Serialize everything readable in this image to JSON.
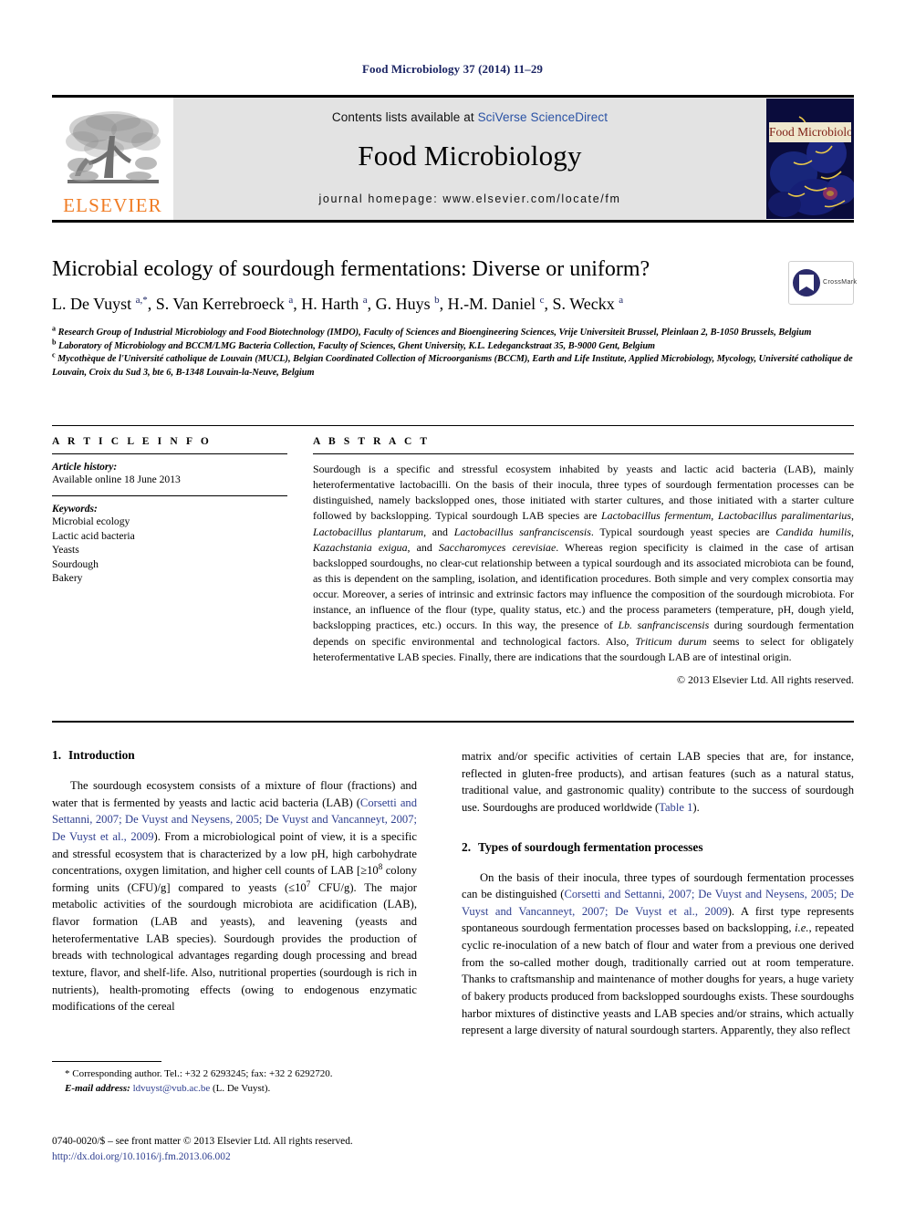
{
  "running_head": "Food Microbiology 37 (2014) 11–29",
  "masthead": {
    "publisher_name": "ELSEVIER",
    "contents_prefix": "Contents lists available at ",
    "contents_link": "SciVerse ScienceDirect",
    "journal_title": "Food Microbiology",
    "homepage": "journal homepage: www.elsevier.com/locate/fm",
    "cover_title": "Food Microbiology"
  },
  "article": {
    "title": "Microbial ecology of sourdough fermentations: Diverse or uniform?",
    "authors_html": "L. De Vuyst <sup>a,*</sup>, S. Van Kerrebroeck <sup>a</sup>, H. Harth <sup>a</sup>, G. Huys <sup>b</sup>, H.-M. Daniel <sup>c</sup>, S. Weckx <sup>a</sup>",
    "crossmark_label": "CrossMark",
    "affiliations": [
      "<sup>a</sup> Research Group of Industrial Microbiology and Food Biotechnology (IMDO), Faculty of Sciences and Bioengineering Sciences, Vrije Universiteit Brussel, Pleinlaan 2, B-1050 Brussels, Belgium",
      "<sup>b</sup> Laboratory of Microbiology and BCCM/LMG Bacteria Collection, Faculty of Sciences, Ghent University, K.L. Ledeganckstraat 35, B-9000 Gent, Belgium",
      "<sup>c</sup> Mycoth&egrave;que de l'Universit&eacute; catholique de Louvain (MUCL), Belgian Coordinated Collection of Microorganisms (BCCM), Earth and Life Institute, Applied Microbiology, Mycology, Universit&eacute; catholique de Louvain, Croix du Sud 3, bte 6, B-1348 Louvain-la-Neuve, Belgium"
    ]
  },
  "article_info": {
    "heading": "A R T I C L E  I N F O",
    "history_label": "Article history:",
    "history_value": "Available online 18 June 2013",
    "keywords_label": "Keywords:",
    "keywords": [
      "Microbial ecology",
      "Lactic acid bacteria",
      "Yeasts",
      "Sourdough",
      "Bakery"
    ]
  },
  "abstract": {
    "heading": "A B S T R A C T",
    "text_html": "Sourdough is a specific and stressful ecosystem inhabited by yeasts and lactic acid bacteria (LAB), mainly heterofermentative lactobacilli. On the basis of their inocula, three types of sourdough fermentation processes can be distinguished, namely backslopped ones, those initiated with starter cultures, and those initiated with a starter culture followed by backslopping. Typical sourdough LAB species are <i>Lactobacillus fermentum</i>, <i>Lactobacillus paralimentarius</i>, <i>Lactobacillus plantarum</i>, and <i>Lactobacillus sanfranciscensis</i>. Typical sourdough yeast species are <i>Candida humilis</i>, <i>Kazachstania exigua</i>, and <i>Saccharomyces cerevisiae</i>. Whereas region specificity is claimed in the case of artisan backslopped sourdoughs, no clear-cut relationship between a typical sourdough and its associated microbiota can be found, as this is dependent on the sampling, isolation, and identification procedures. Both simple and very complex consortia may occur. Moreover, a series of intrinsic and extrinsic factors may influence the composition of the sourdough microbiota. For instance, an influence of the flour (type, quality status, etc.) and the process parameters (temperature, pH, dough yield, backslopping practices, etc.) occurs. In this way, the presence of <i>Lb. sanfranciscensis</i> during sourdough fermentation depends on specific environmental and technological factors. Also, <i>Triticum durum</i> seems to select for obligately heterofermentative LAB species. Finally, there are indications that the sourdough LAB are of intestinal origin.",
    "copyright": "© 2013 Elsevier Ltd. All rights reserved."
  },
  "body": {
    "section1": {
      "number": "1.",
      "title": "Introduction",
      "paragraph_html": "The sourdough ecosystem consists of a mixture of flour (fractions) and water that is fermented by yeasts and lactic acid bacteria (LAB) (<span class=\"ref\">Corsetti and Settanni, 2007; De Vuyst and Neysens, 2005; De Vuyst and Vancanneyt, 2007; De Vuyst et al., 2009</span>). From a microbiological point of view, it is a specific and stressful ecosystem that is characterized by a low pH, high carbohydrate concentrations, oxygen limitation, and higher cell counts of LAB [&ge;10<sup>8</sup> colony forming units (CFU)/g] compared to yeasts (&le;10<sup>7</sup> CFU/g). The major metabolic activities of the sourdough microbiota are acidification (LAB), flavor formation (LAB and yeasts), and leavening (yeasts and heterofermentative LAB species). Sourdough provides the production of breads with technological advantages regarding dough processing and bread texture, flavor, and shelf-life. Also, nutritional properties (sourdough is rich in nutrients), health-promoting effects (owing to endogenous enzymatic modifications of the cereal"
    },
    "right_continued_html": "matrix and/or specific activities of certain LAB species that are, for instance, reflected in gluten-free products), and artisan features (such as a natural status, traditional value, and gastronomic quality) contribute to the success of sourdough use. Sourdoughs are produced worldwide (<span class=\"ref\">Table 1</span>).",
    "section2": {
      "number": "2.",
      "title": "Types of sourdough fermentation processes",
      "paragraph_html": "On the basis of their inocula, three types of sourdough fermentation processes can be distinguished (<span class=\"ref\">Corsetti and Settanni, 2007; De Vuyst and Neysens, 2005; De Vuyst and Vancanneyt, 2007; De Vuyst et al., 2009</span>). A first type represents spontaneous sourdough fermentation processes based on backslopping, <i>i.e.</i>, repeated cyclic re-inoculation of a new batch of flour and water from a previous one derived from the so-called mother dough, traditionally carried out at room temperature. Thanks to craftsmanship and maintenance of mother doughs for years, a huge variety of bakery products produced from backslopped sourdoughs exists. These sourdoughs harbor mixtures of distinctive yeasts and LAB species and/or strains, which actually represent a large diversity of natural sourdough starters. Apparently, they also reflect"
    }
  },
  "footnote": {
    "corresponding_html": "* Corresponding author. Tel.: +32 2 6293245; fax: +32 2 6292720.",
    "email_html": "<i>E-mail address:</i> <span class=\"mailto\">ldvuyst@vub.ac.be</span> (L. De Vuyst)."
  },
  "imprint": {
    "issn_line": "0740-0020/$ – see front matter © 2013 Elsevier Ltd. All rights reserved.",
    "doi": "http://dx.doi.org/10.1016/j.fm.2013.06.002"
  }
}
